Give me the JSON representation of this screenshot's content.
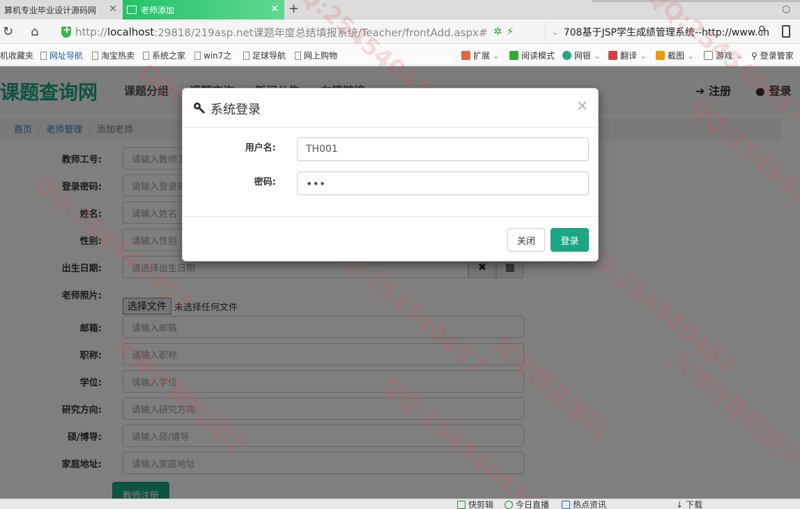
{
  "browser": {
    "tabs": [
      {
        "label": "算机专业毕业设计源码网",
        "active": false
      },
      {
        "label": "老师添加",
        "active": true
      }
    ],
    "url_prefix": "http://",
    "url_host": "localhost",
    "url_rest": ":29818/219asp.net课题年度总结填报系统/Teacher/frontAdd.aspx#",
    "search_text": "708基于JSP学生成绩管理系统--http://www.ch",
    "bookmarks": [
      "机收藏夹",
      "网址导航",
      "淘宝热卖",
      "系统之家",
      "win7之",
      "足球导航",
      "网上购物",
      "扩展",
      "阅读模式",
      "网银",
      "翻译",
      "截图",
      "游戏",
      "登录管家"
    ]
  },
  "site": {
    "brand": "课题查询网",
    "nav": [
      "课题分组",
      "课题查询",
      "新闻公告",
      "友情链接"
    ],
    "register": "注册",
    "login": "登录"
  },
  "breadcrumb": {
    "home": "首页",
    "section": "老师管理",
    "current": "添加老师"
  },
  "form": {
    "fields": [
      {
        "label": "教师工号:",
        "placeholder": "请输入教师工号"
      },
      {
        "label": "登录密码:",
        "placeholder": "请输入登录密码"
      },
      {
        "label": "姓名:",
        "placeholder": "请输入姓名"
      },
      {
        "label": "性别:",
        "placeholder": "请输入性别"
      }
    ],
    "birthday": {
      "label": "出生日期:",
      "placeholder": "请选择出生日期"
    },
    "photo": {
      "label": "老师照片:",
      "button": "选择文件",
      "status": "未选择任何文件"
    },
    "fields2": [
      {
        "label": "邮箱:",
        "placeholder": "请输入邮箱"
      },
      {
        "label": "职称:",
        "placeholder": "请输入职称"
      },
      {
        "label": "学位:",
        "placeholder": "请输入学位"
      },
      {
        "label": "研究方向:",
        "placeholder": "请输入研究方向"
      },
      {
        "label": "硕/博导:",
        "placeholder": "请输入硕/博导"
      },
      {
        "label": "家庭地址:",
        "placeholder": "请输入家庭地址"
      }
    ],
    "submit": "教师注册"
  },
  "modal": {
    "title": "系统登录",
    "close_symbol": "×",
    "username_label": "用户名:",
    "username_value": "TH001",
    "password_label": "密码:",
    "password_value": "•••",
    "close_button": "关闭",
    "login_button": "登录"
  },
  "statusbar": [
    "快剪辑",
    "今日直播",
    "热点资讯",
    "下载"
  ],
  "watermarks": [
    "QQ:254540457",
    "大神计算机设计",
    "常年精品源码"
  ]
}
